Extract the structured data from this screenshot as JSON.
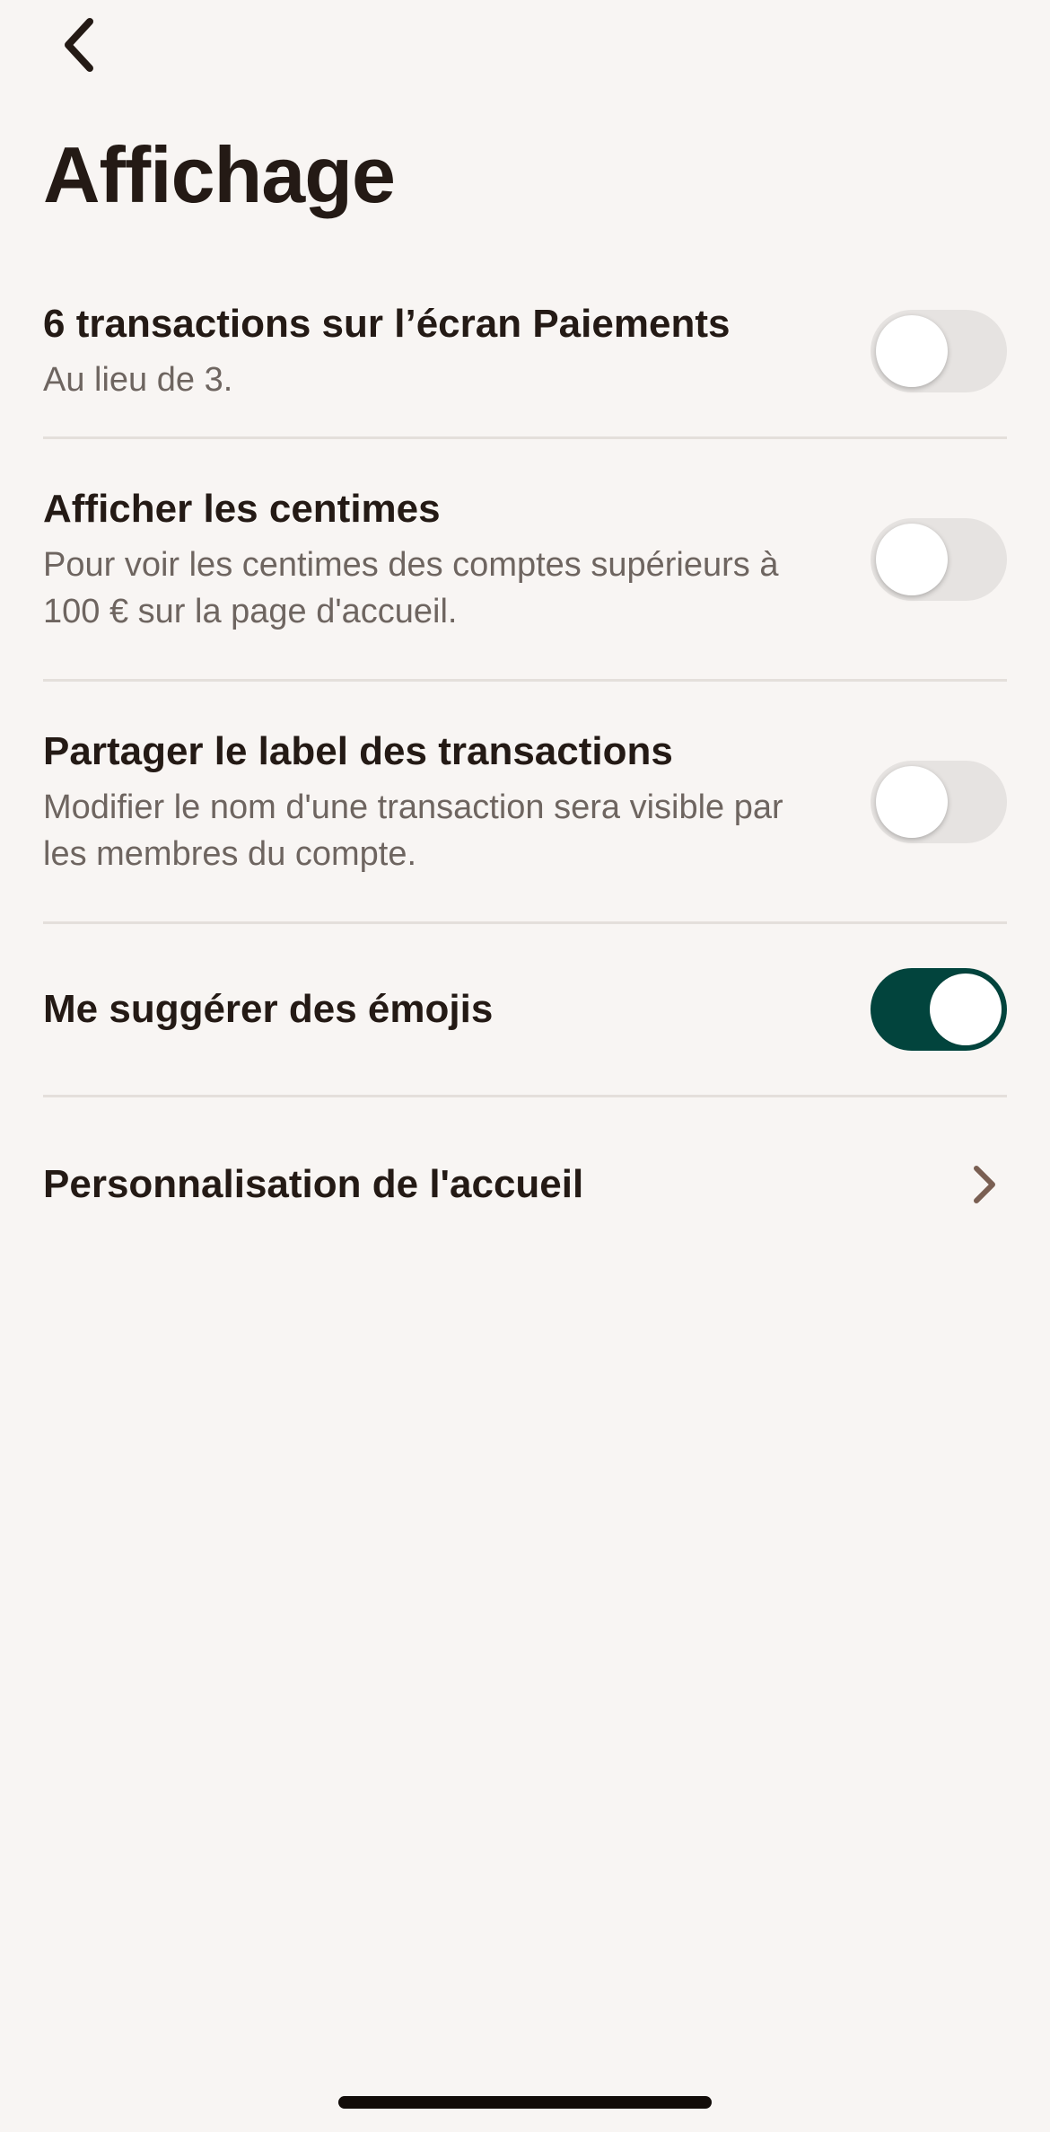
{
  "header": {
    "back_icon": "chevron-left-icon",
    "title": "Affichage"
  },
  "settings": [
    {
      "title": "6 transactions sur l’écran Paiements",
      "description": "Au lieu de 3.",
      "control": "toggle",
      "enabled": false
    },
    {
      "title": "Afficher les centimes",
      "description": "Pour voir les centimes des comptes supérieurs à 100 € sur la page d'accueil.",
      "control": "toggle",
      "enabled": false
    },
    {
      "title": "Partager le label des transactions",
      "description": "Modifier le nom d'une transaction sera visible par les membres du compte.",
      "control": "toggle",
      "enabled": false
    },
    {
      "title": "Me suggérer des émojis",
      "description": "",
      "control": "toggle",
      "enabled": true
    },
    {
      "title": "Personnalisation de l'accueil",
      "description": "",
      "control": "chevron-right-icon"
    }
  ],
  "colors": {
    "background": "#f8f5f3",
    "text_primary": "#241a15",
    "text_secondary": "#6e6560",
    "toggle_off": "#e6e3e1",
    "toggle_on": "#02443d",
    "divider": "#e4dfdb",
    "chevron": "#7a5f52"
  }
}
